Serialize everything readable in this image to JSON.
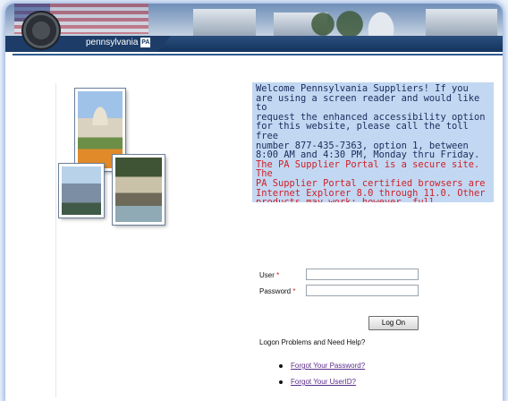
{
  "header": {
    "brand_text": "pennsylvania",
    "brand_badge": "PA"
  },
  "notice": {
    "welcome_text": "Welcome Pennsylvania Suppliers! If you\nare using a screen reader and would like to\nrequest the enhanced accessibility option\nfor this website, please call the toll free\nnumber 877-435-7363, option 1, between\n8:00 AM and 4:30 PM, Monday thru Friday.",
    "secure_text": "The PA Supplier Portal is a secure site. The\nPA Supplier Portal certified browsers are\nInternet Explorer 8.0 through 11.0. Other\nproducts may work; however, full\nfunctionality cannot be assured."
  },
  "login": {
    "user_label": "User",
    "password_label": "Password",
    "required_marker": "*",
    "user_value": "",
    "password_value": "",
    "logon_button": "Log On",
    "help_title": "Logon Problems and Need Help?",
    "links": [
      "Forgot Your Password?",
      "Forgot Your UserID?"
    ]
  }
}
